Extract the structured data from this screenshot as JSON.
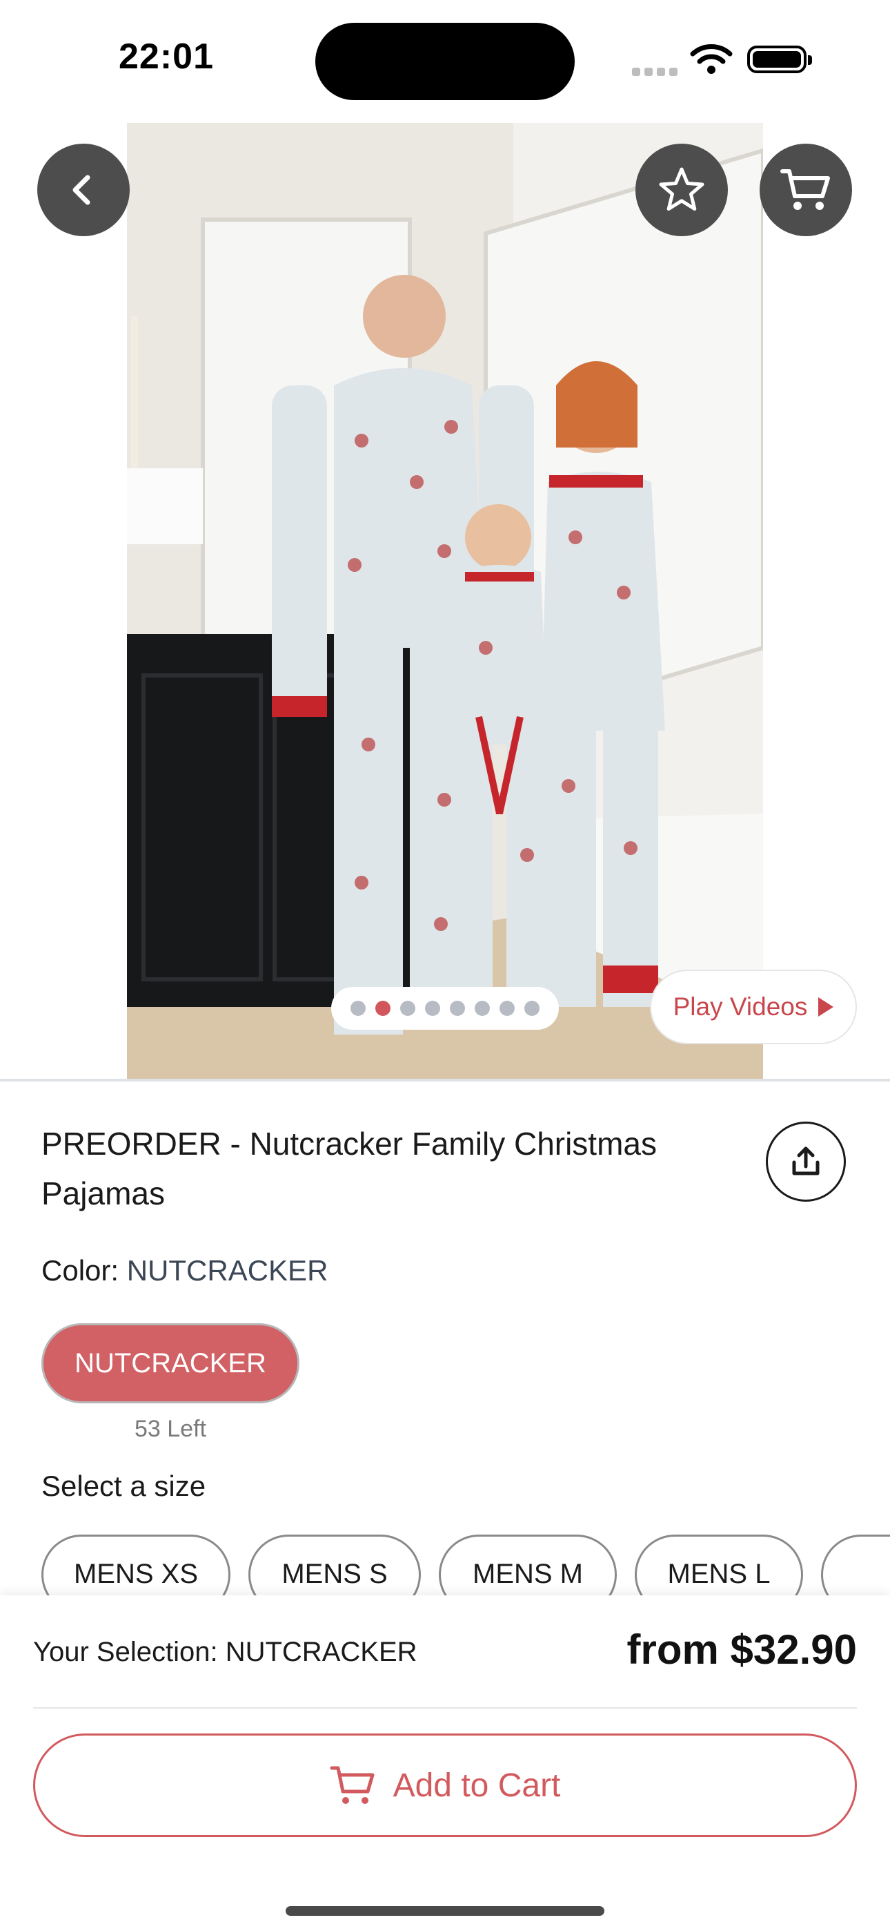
{
  "status_bar": {
    "time": "22:01"
  },
  "gallery": {
    "slide_count": 8,
    "active_slide": 2,
    "play_videos_label": "Play Videos"
  },
  "product": {
    "title": "PREORDER - Nutcracker Family Christmas Pajamas",
    "color_label": "Color:",
    "color_value": "NUTCRACKER",
    "color_options": [
      {
        "label": "NUTCRACKER",
        "stock": "53 Left",
        "selected": true
      }
    ],
    "size_prompt": "Select a size",
    "sizes": [
      "MENS XS",
      "MENS S",
      "MENS M",
      "MENS L"
    ]
  },
  "bottom_bar": {
    "selection_label": "Your Selection: NUTCRACKER",
    "price": "from $32.90",
    "add_to_cart_label": "Add to Cart"
  },
  "icons": [
    "chevron-left-icon",
    "star-icon",
    "cart-icon",
    "share-icon",
    "play-icon",
    "add-to-cart-icon"
  ],
  "colors": {
    "accent": "#d25a5e",
    "chip": "#d16164",
    "overlay_button": "#4d4d4d"
  }
}
